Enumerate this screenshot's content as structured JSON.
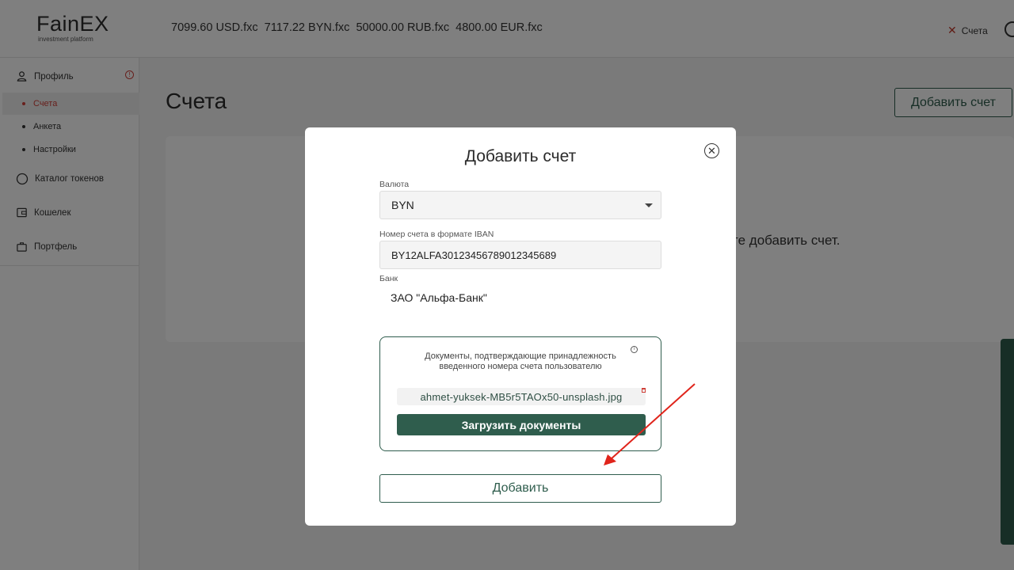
{
  "header": {
    "logo": "FainEX",
    "logo_sub": "investment platform",
    "balances": [
      "7099.60 USD.fxc",
      "7117.22 BYN.fxc",
      "50000.00 RUB.fxc",
      "4800.00 EUR.fxc"
    ],
    "accounts_link": "Счета"
  },
  "sidebar": {
    "profile": "Профиль",
    "sub_items": [
      "Счета",
      "Анкета",
      "Настройки"
    ],
    "catalog": "Каталог токенов",
    "wallet": "Кошелек",
    "portfolio": "Портфель"
  },
  "main": {
    "title": "Счета",
    "add_button": "Добавить счет",
    "empty_text": "те добавить счет."
  },
  "modal": {
    "title": "Добавить счет",
    "currency_label": "Валюта",
    "currency_value": "BYN",
    "iban_label": "Номер счета в формате IBAN",
    "iban_value": "BY12ALFA30123456789012345689",
    "bank_label": "Банк",
    "bank_value": "ЗАО \"Альфа-Банк\"",
    "docs_text": "Документы, подтверждающие принадлежность введенного номера счета пользователю",
    "file_name": "ahmet-yuksek-MB5r5TAOx50-unsplash.jpg",
    "upload_button": "Загрузить документы",
    "submit_button": "Добавить"
  },
  "colors": {
    "brand_green": "#2f5d4d",
    "accent_red": "#d0413a",
    "arrow_red": "#e0241b"
  }
}
